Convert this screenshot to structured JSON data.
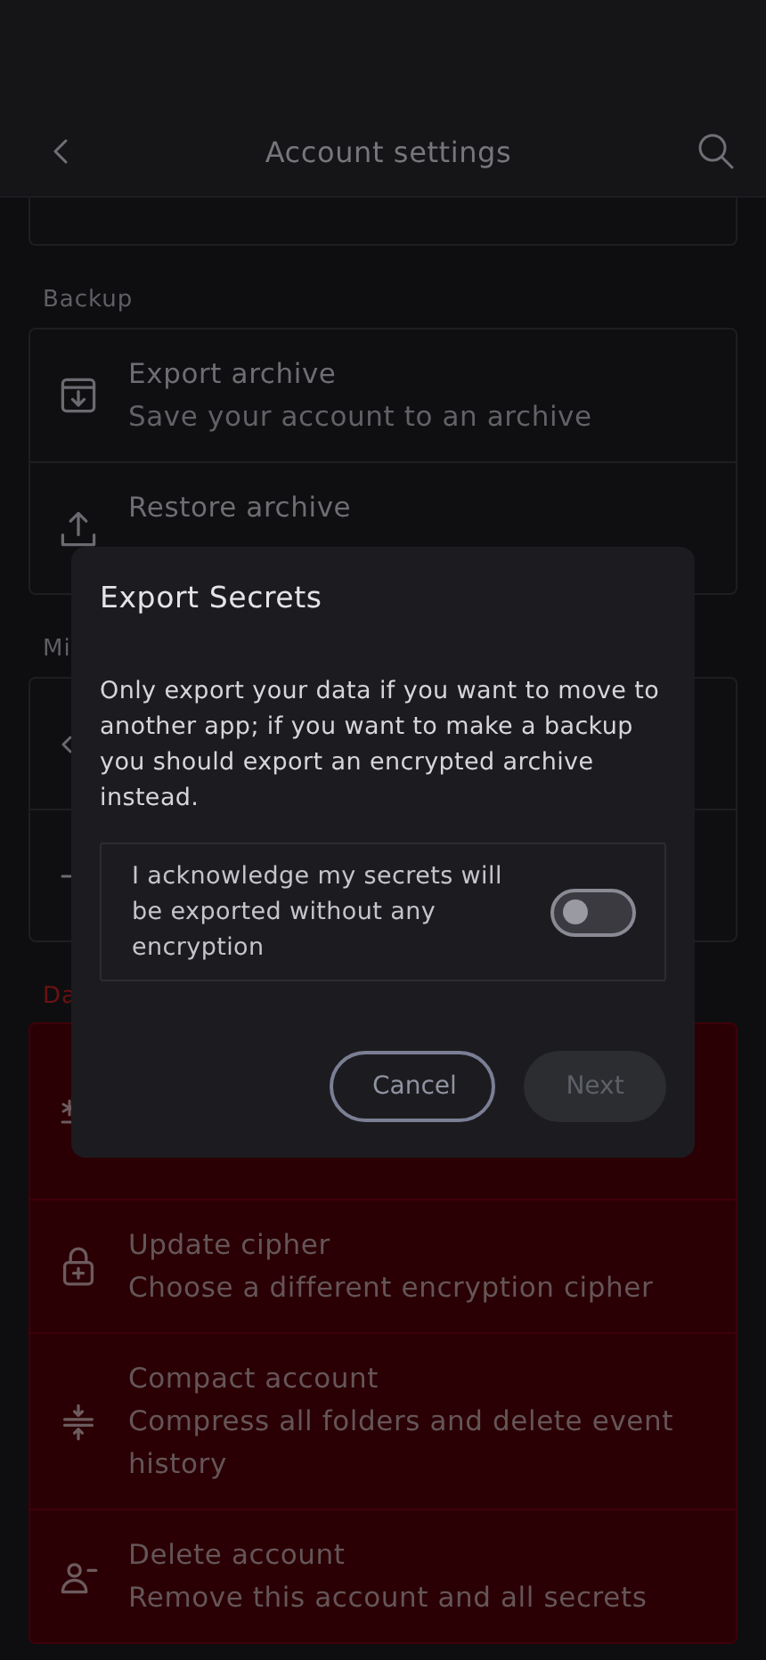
{
  "header": {
    "title": "Account settings"
  },
  "sections": [
    {
      "items": [
        {
          "kind": "covered"
        }
      ]
    },
    {
      "title": "Backup",
      "items": [
        {
          "kind": "text",
          "title": "Export archive",
          "subtitle": "Save your account to an archive"
        },
        {
          "kind": "text",
          "title": "Restore archive"
        }
      ]
    },
    {
      "title": "Mi",
      "items": [
        {
          "kind": "covered"
        },
        {
          "kind": "covered"
        }
      ]
    },
    {
      "title": "Da",
      "danger": true,
      "items": [
        {
          "kind": "covered"
        },
        {
          "kind": "text",
          "title": "Update cipher",
          "subtitle": "Choose a different encryption cipher"
        },
        {
          "kind": "text",
          "title": "Compact account",
          "subtitle": "Compress all folders and delete event history"
        },
        {
          "kind": "text",
          "title": "Delete account",
          "subtitle": "Remove this account and all secrets"
        }
      ]
    }
  ],
  "dialog": {
    "title": "Export Secrets",
    "message": "Only export your data if you want to move to another app; if you want to make a backup you should export an encrypted archive instead.",
    "acknowledge": {
      "label": "I acknowledge my secrets will be exported without any encryption",
      "on": false
    },
    "buttons": [
      {
        "label": "Cancel",
        "kind": "outline",
        "disabled": false
      },
      {
        "label": "Next",
        "kind": "filled",
        "disabled": true
      }
    ]
  }
}
